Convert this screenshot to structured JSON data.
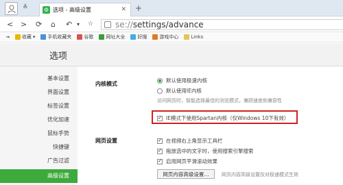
{
  "tab": {
    "title": "选项 - 高级设置",
    "new_tab": "+"
  },
  "nav": {
    "back": "<",
    "forward": ">",
    "refresh": "C",
    "home": "⌂",
    "undo": "↶",
    "url_prefix": "se://",
    "url_path": "settings/advance"
  },
  "bookmarks": [
    {
      "label": "收藏",
      "color": "#f0b400"
    },
    {
      "label": "手机收藏夹",
      "color": "#4a90d9"
    },
    {
      "label": "谷歌",
      "color": "#d9534f"
    },
    {
      "label": "网址大全",
      "color": "#3c9c3c"
    },
    {
      "label": "好搜",
      "color": "#3cb0e0"
    },
    {
      "label": "游戏中心",
      "color": "#e07b20"
    },
    {
      "label": "Links",
      "color": "#e6c35c"
    }
  ],
  "page": {
    "title": "选项"
  },
  "sidebar": {
    "items": [
      {
        "label": "基本设置"
      },
      {
        "label": "界面设置"
      },
      {
        "label": "标签设置"
      },
      {
        "label": "优化加速"
      },
      {
        "label": "鼠标手势"
      },
      {
        "label": "快捷键"
      },
      {
        "label": "广告过滤"
      },
      {
        "label": "高级设置"
      }
    ],
    "active_index": 7
  },
  "kernel": {
    "label": "内核模式",
    "option_fast": "默认使用极速内核",
    "option_ie": "默认使用IE内核",
    "hint": "访问网页时，智能选择最佳的浏览模式，兼顾速度和兼容性",
    "spartan": "IE模式下使用Spartan内核（仅Windows 10下有效）"
  },
  "webpage": {
    "label": "网页设置",
    "toolbar": "在视频右上角显示工具栏",
    "drag_search": "拖放选中的文字时，使用搜索引擎搜索",
    "smooth_scroll": "启用网页平滑滚动效果",
    "advanced_button": "网页内容高级设置...",
    "advanced_hint": "网页内容高级设置仅对极速模式生效"
  },
  "colors": {
    "accent_green": "#3caa3c",
    "highlight_red": "#d02020"
  }
}
